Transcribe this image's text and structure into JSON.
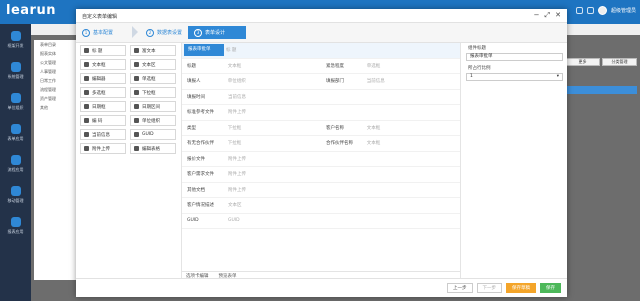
{
  "app": {
    "logo": "learun",
    "user_name": "超级管理员"
  },
  "nav": [
    "框架开发",
    "系统管理",
    "单位组织",
    "表单应用",
    "流程应用",
    "移动管理",
    "报表应用"
  ],
  "background": {
    "panel_title": "表单目录",
    "items": [
      "表单目录",
      "报表实体",
      "公文管理",
      "人事管理",
      "日常工作",
      "流程管理",
      "资产管理",
      "其他"
    ],
    "buttons": [
      "更多",
      "分类管理"
    ]
  },
  "modal": {
    "title": "自定义表单编辑",
    "controls": {
      "minimize": "−",
      "maximize": "⤢",
      "close": "✕"
    },
    "steps": [
      {
        "num": "1",
        "label": "基本配置"
      },
      {
        "num": "2",
        "label": "数据表设置"
      },
      {
        "num": "3",
        "label": "表单设计"
      }
    ],
    "palette": [
      [
        "标 题",
        "富文本"
      ],
      [
        "文本框",
        "文本区"
      ],
      [
        "编辑器",
        "单选框"
      ],
      [
        "多选框",
        "下拉框"
      ],
      [
        "日期框",
        "日期区间"
      ],
      [
        "编 码",
        "单位组织"
      ],
      [
        "当前信息",
        "GUID"
      ],
      [
        "附件上传",
        "编辑表格"
      ]
    ],
    "canvas": {
      "header_tag": "报表审批单",
      "header_val": "标 题",
      "rows": [
        [
          {
            "l": "标题",
            "v": "文本框"
          },
          {
            "l": "紧急程度",
            "v": "单选框"
          }
        ],
        [
          {
            "l": "填报人",
            "v": "单位组织"
          },
          {
            "l": "填报部门",
            "v": "当前信息"
          }
        ],
        [
          {
            "l": "填报时间",
            "v": "当前信息"
          }
        ],
        [
          {
            "l": "标准参考文件",
            "v": "附件上传"
          }
        ],
        [
          {
            "l": "类型",
            "v": "下拉框"
          },
          {
            "l": "客户名称",
            "v": "文本框"
          }
        ],
        [
          {
            "l": "有无合作伙伴",
            "v": "下拉框"
          },
          {
            "l": "合作伙伴名称",
            "v": "文本框"
          }
        ],
        [
          {
            "l": "报价文件",
            "v": "附件上传"
          }
        ],
        [
          {
            "l": "客户需求文件",
            "v": "附件上传"
          }
        ],
        [
          {
            "l": "其他文档",
            "v": "附件上传"
          }
        ],
        [
          {
            "l": "客户情况描述",
            "v": "文本区"
          }
        ],
        [
          {
            "l": "GUID",
            "v": "GUID"
          }
        ]
      ],
      "footer": [
        "选项卡编辑",
        "预览表单"
      ]
    },
    "props": {
      "label1": "组件标题",
      "value1": "报表审批单",
      "label2": "所占行比例",
      "value2": "1"
    },
    "footer": {
      "prev": "上一步",
      "next": "下一步",
      "save_draft": "保存草稿",
      "save": "保存"
    }
  },
  "colors": {
    "primary": "#2f88d6",
    "orange": "#f4a52a",
    "green": "#4db85a"
  }
}
